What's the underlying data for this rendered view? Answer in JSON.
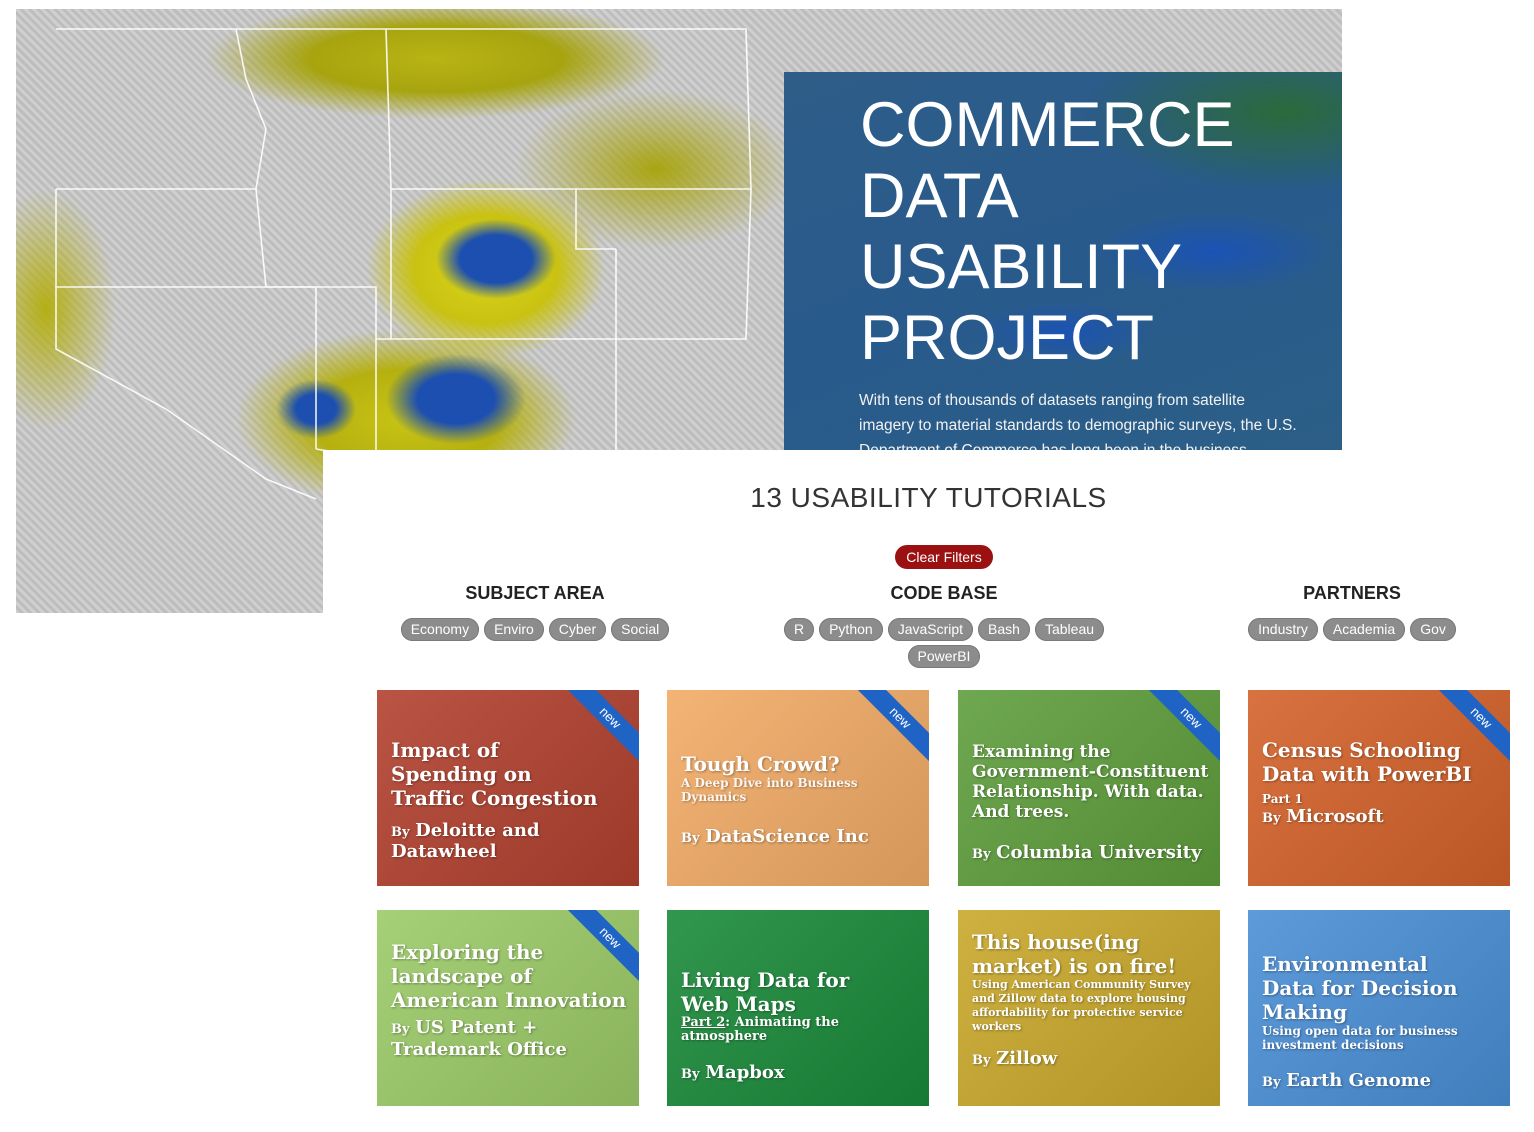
{
  "hero": {
    "title_lines": [
      "COMMERCE",
      "DATA",
      "USABILITY",
      "PROJECT"
    ],
    "description": "With tens of thousands of datasets ranging from satellite imagery to material standards to demographic surveys, the U.S. Department of Commerce has long been in the business"
  },
  "tutorials": {
    "count_label": "13 USABILITY TUTORIALS",
    "clear_filters": "Clear Filters"
  },
  "filters": {
    "subject_area": {
      "heading": "SUBJECT AREA",
      "options": [
        "Economy",
        "Enviro",
        "Cyber",
        "Social"
      ]
    },
    "code_base": {
      "heading": "CODE BASE",
      "options": [
        "R",
        "Python",
        "JavaScript",
        "Bash",
        "Tableau",
        "PowerBI"
      ]
    },
    "partners": {
      "heading": "PARTNERS",
      "options": [
        "Industry",
        "Academia",
        "Gov"
      ]
    }
  },
  "cards": [
    {
      "title": "Impact of Spending on Traffic Congestion",
      "subtitle": "",
      "by": "By",
      "author": "Deloitte and Datawheel",
      "badge": "new",
      "color": "#b2412f"
    },
    {
      "title": "Tough Crowd?",
      "subtitle": "A Deep Dive into Business Dynamics",
      "by": "By",
      "author": "DataScience Inc",
      "badge": "new",
      "color": "#f2ab66"
    },
    {
      "title": "Examining the Government-Constituent Relationship. With data. And trees.",
      "subtitle": "",
      "by": "By",
      "author": "Columbia University",
      "badge": "new",
      "color": "#5e9e3c"
    },
    {
      "title": "Census Schooling Data with PowerBI",
      "subtitle": "Part 1",
      "by": "By",
      "author": "Microsoft",
      "badge": "new",
      "color": "#d4622a"
    },
    {
      "title": "Exploring the landscape of American Innovation",
      "subtitle": "",
      "by": "By",
      "author": "US Patent + Trademark Office",
      "badge": "new",
      "color": "#9ccb68"
    },
    {
      "title": "Living Data for Web Maps",
      "subtitle_link": "Part 2",
      "subtitle": ": Animating the atmosphere",
      "by": "By",
      "author": "Mapbox",
      "badge": "",
      "color": "#1a8a3a"
    },
    {
      "title": "This house(ing market) is on fire!",
      "subtitle": "Using American Community Survey and Zillow data to explore housing affordability for protective service workers",
      "by": "By",
      "author": "Zillow",
      "badge": "",
      "color": "#c9a82b"
    },
    {
      "title": "Environmental Data for Decision Making",
      "subtitle": "Using open data for business investment decisions",
      "by": "By",
      "author": "Earth Genome",
      "badge": "",
      "color": "#4a8fd6"
    }
  ]
}
